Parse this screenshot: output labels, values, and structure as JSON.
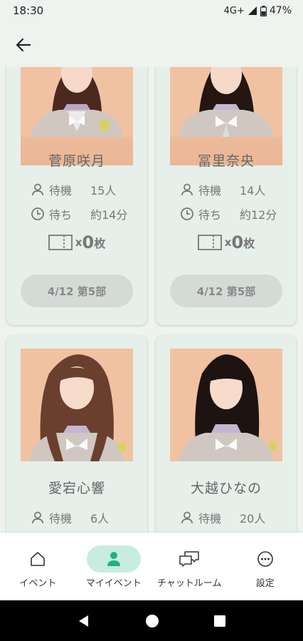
{
  "status": {
    "time": "18:30",
    "network": "4G+",
    "battery": "47%"
  },
  "cards": [
    {
      "name": "菅原咲月",
      "waiting_label": "待機",
      "waiting_value": "15人",
      "wait_time_label": "待ち",
      "wait_time_value": "約14分",
      "ticket_x": "x",
      "ticket_count": "0",
      "ticket_unit": "枚",
      "slot": "4/12 第5部"
    },
    {
      "name": "冨里奈央",
      "waiting_label": "待機",
      "waiting_value": "14人",
      "wait_time_label": "待ち",
      "wait_time_value": "約12分",
      "ticket_x": "x",
      "ticket_count": "0",
      "ticket_unit": "枚",
      "slot": "4/12 第5部"
    },
    {
      "name": "愛宕心響",
      "waiting_label": "待機",
      "waiting_value": "6人"
    },
    {
      "name": "大越ひなの",
      "waiting_label": "待機",
      "waiting_value": "20人"
    }
  ],
  "nav": [
    {
      "label": "イベント",
      "icon": "home-icon"
    },
    {
      "label": "マイイベント",
      "icon": "person-icon",
      "active": true
    },
    {
      "label": "チャットルーム",
      "icon": "chat-icon"
    },
    {
      "label": "設定",
      "icon": "more-icon"
    }
  ],
  "colors": {
    "accent": "#1fb08a",
    "active_pill": "#c9ece0",
    "card_bg": "#e6efe9",
    "page_bg": "#eef3ef"
  }
}
